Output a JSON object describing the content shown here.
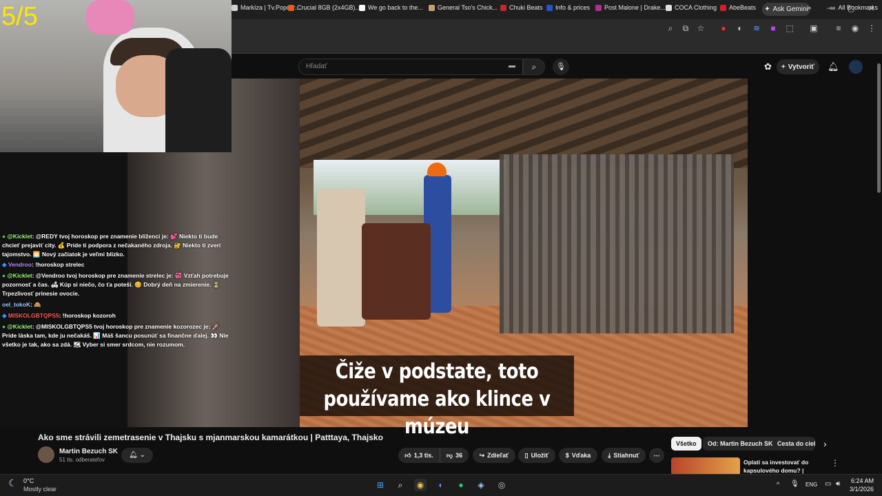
{
  "browser": {
    "ask_gemini": "Ask Gemini",
    "bookmarks": [
      {
        "label": "Markíza | Tv.Popcor...",
        "color": "#d0d0d0"
      },
      {
        "label": "Crucial 8GB (2x4GB)...",
        "color": "#e65c1f"
      },
      {
        "label": "We go back to the...",
        "color": "#ffffff"
      },
      {
        "label": "General Tso's Chick...",
        "color": "#c8a070"
      },
      {
        "label": "Chuki Beats",
        "color": "#c1272d"
      },
      {
        "label": "Info & prices",
        "color": "#2255cc"
      },
      {
        "label": "Post Malone | Drake...",
        "color": "#b03090"
      },
      {
        "label": "COCA Clothing",
        "color": "#e0e0e0"
      },
      {
        "label": "AbeBeats",
        "color": "#d0202a"
      }
    ],
    "all_bookmarks": "All Bookmarks"
  },
  "youtube": {
    "search_placeholder": "Hľadať",
    "create_label": "Vytvoriť",
    "subtitle_line1": "Čiže v podstate, toto",
    "subtitle_line2": "používame ako klince v múzeu",
    "video_title": "Ako sme strávili zemetrasenie v Thajsku s mjanmarskou kamarátkou | Patttaya, Thajsko",
    "channel_name": "Martin Bezuch SK",
    "channel_subs": "51 tis. odberateľov",
    "actions": {
      "likes": "1,3 tis.",
      "dislikes": "36",
      "share": "Zdieľať",
      "save": "Uložiť",
      "thanks": "Vďaka",
      "download": "Stiahnuť"
    },
    "chips": [
      "Všetko",
      "Od: Martin Bezuch SK",
      "Cesta do cieľa"
    ],
    "recommended_title": "Oplatí sa investovať do kapsulového domu? | Pattaya, ..."
  },
  "stream": {
    "counter": "5/5",
    "chat": [
      {
        "user": "@Kicklet",
        "text": ": @REDY tvoj horoskop pre znamenie blíženci je: 💕 Niekto ti bude chcieť prejaviť city. 💰 Príde ti podpora z nečakaného zdroja. 🔐 Niekto ti zverí tajomstvo. 🌅 Nový začiatok je veľmi blízko."
      },
      {
        "user": "Vendroo",
        "text": ": !horoskop strelec"
      },
      {
        "user": "@Kicklet",
        "text": ": @Vendroo tvoj horoskop pre znamenie strelec je: 💞 Vzťah potrebuje pozornosť a čas. 🛋 Kúp si niečo, čo ťa poteší. 😊 Dobrý deň na zmierenie. ⏳ Trpezlivosť prinesie ovocie."
      },
      {
        "user": "oel_tokoK",
        "text": ": 🙈"
      },
      {
        "user": "MISKOLGBTQPS5",
        "text": ": !horoskop kozoroh"
      },
      {
        "user": "@Kicklet",
        "text": ": @MISKOLGBTQPS5 tvoj horoskop pre znamenie kozorozec je: 🚀 Príde láska tam, kde ju nečakáš. 📊 Máš šancu posunúť sa finančne ďalej. 👀 Nie všetko je tak, ako sa zdá. 🗺 Vyber si smer srdcom, nie rozumom."
      }
    ]
  },
  "taskbar": {
    "temperature": "0°C",
    "weather": "Mostly clear",
    "language": "ENG",
    "time": "6:24 AM",
    "date": "3/1/2026"
  }
}
